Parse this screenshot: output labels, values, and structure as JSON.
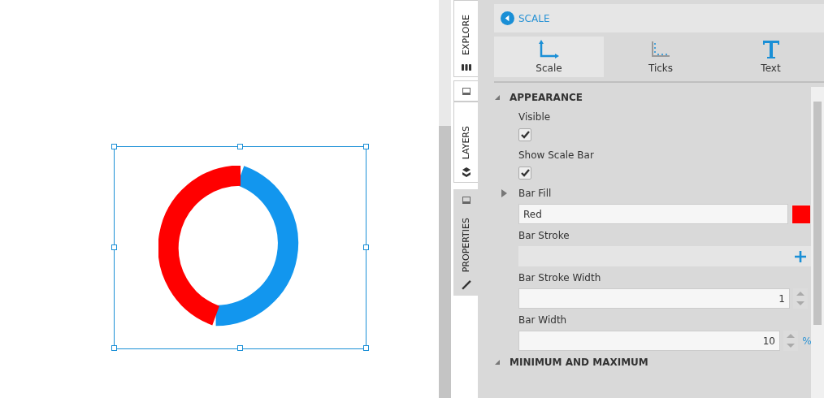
{
  "side_tabs": [
    {
      "label": "EXPLORE",
      "selected": false
    },
    {
      "label": "LAYERS",
      "selected": false
    },
    {
      "label": "PROPERTIES",
      "selected": true
    }
  ],
  "header": {
    "title": "SCALE"
  },
  "mode_tabs": [
    {
      "label": "Scale",
      "kind": "scale",
      "selected": true
    },
    {
      "label": "Ticks",
      "kind": "ticks",
      "selected": false
    },
    {
      "label": "Text",
      "kind": "text",
      "selected": false
    }
  ],
  "sections": [
    {
      "title": "APPEARANCE",
      "expanded": true,
      "properties": [
        {
          "kind": "checkbox",
          "label": "Visible",
          "checked": true
        },
        {
          "kind": "checkbox",
          "label": "Show Scale Bar",
          "checked": true
        },
        {
          "kind": "color",
          "label": "Bar Fill",
          "expanded": false,
          "value": "Red",
          "color": "#ff0000"
        },
        {
          "kind": "add",
          "label": "Bar Stroke"
        },
        {
          "kind": "number",
          "label": "Bar Stroke Width",
          "value": "1"
        },
        {
          "kind": "number",
          "label": "Bar Width",
          "value": "10",
          "unit": "%"
        }
      ]
    },
    {
      "title": "MINIMUM AND MAXIMUM",
      "expanded": true
    }
  ]
}
